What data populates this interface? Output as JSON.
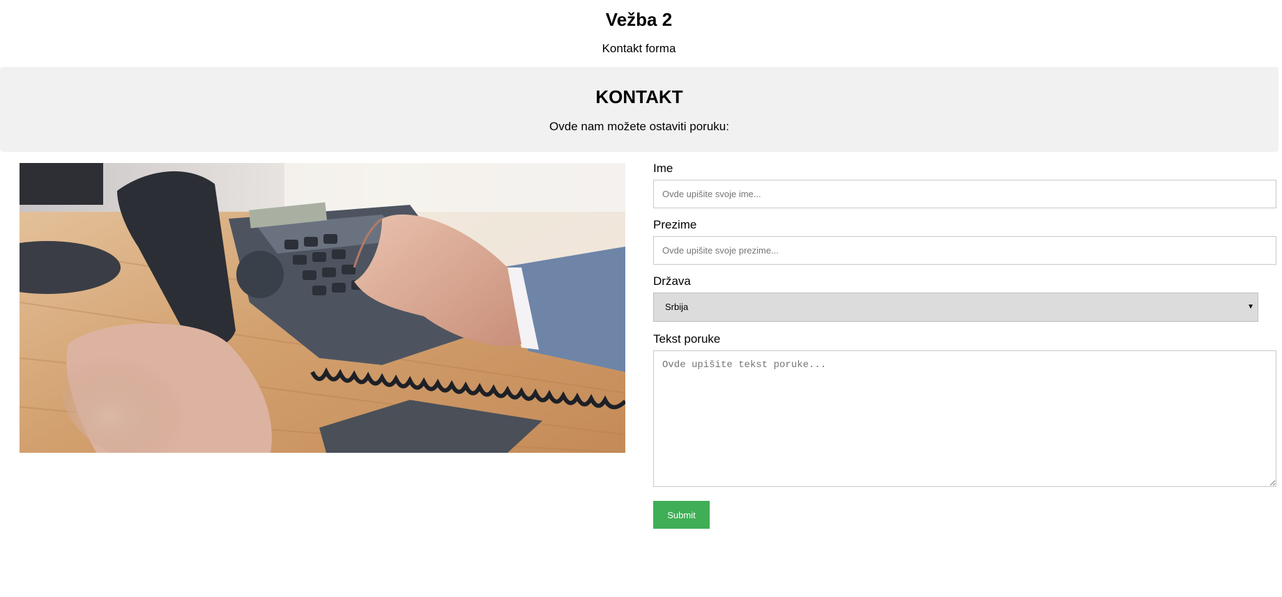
{
  "header": {
    "title": "Vežba 2",
    "subtitle": "Kontakt forma"
  },
  "banner": {
    "title": "KONTAKT",
    "text": "Ovde nam možete ostaviti poruku:"
  },
  "image": {
    "alt": "phone-on-desk-photo"
  },
  "form": {
    "first_name": {
      "label": "Ime",
      "placeholder": "Ovde upišite svoje ime..."
    },
    "last_name": {
      "label": "Prezime",
      "placeholder": "Ovde upišite svoje prezime..."
    },
    "country": {
      "label": "Država",
      "selected": "Srbija"
    },
    "message": {
      "label": "Tekst poruke",
      "placeholder": "Ovde upišite tekst poruke..."
    },
    "submit_label": "Submit"
  },
  "colors": {
    "banner_bg": "#f1f1f1",
    "submit_bg": "#3fae56",
    "select_bg": "#dcdcdc"
  }
}
